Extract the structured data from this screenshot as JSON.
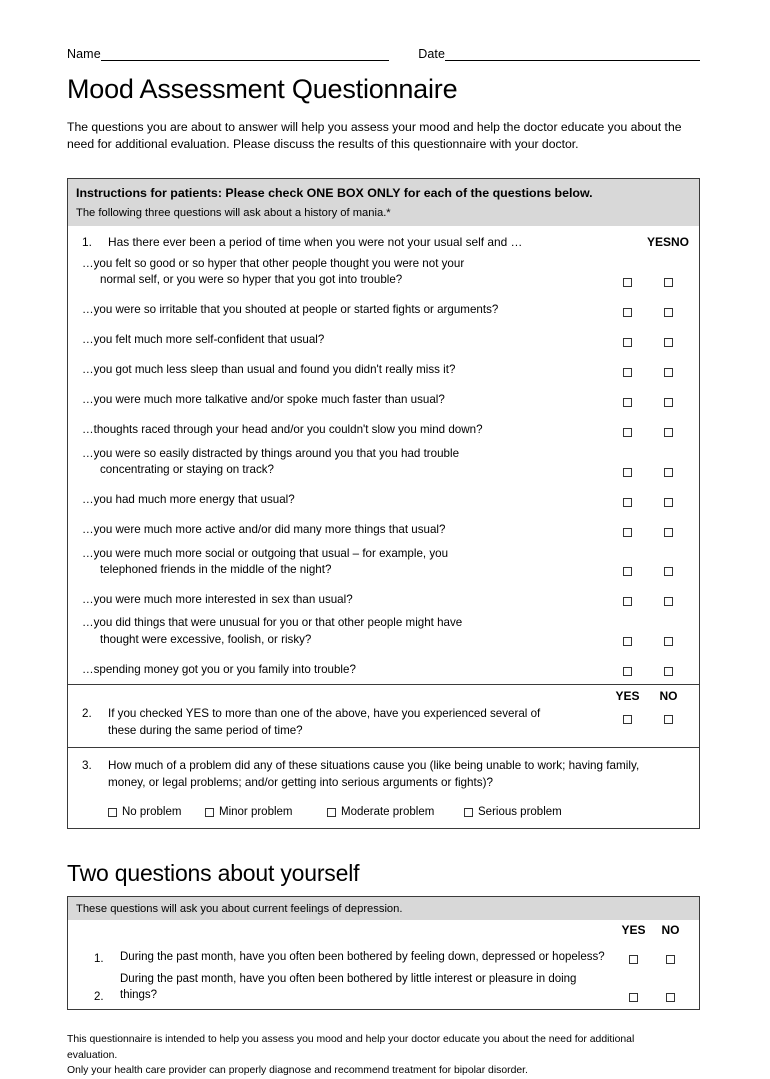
{
  "header": {
    "name_label": "Name",
    "date_label": "Date",
    "title": "Mood Assessment Questionnaire",
    "intro": "The questions you are about to answer will help you assess your mood and help the doctor educate you about the need for additional evaluation. Please discuss the results of this questionnaire with your doctor."
  },
  "mania": {
    "instructions_bold": "Instructions for patients: Please check ONE BOX ONLY for each of the questions below.",
    "instructions_sub": "The following three questions will ask about a history of mania.*",
    "yes_label": "YES",
    "no_label": "NO",
    "q1": {
      "number": "1.",
      "label": "Has there ever been a period of time when you were not your usual self and …",
      "items": [
        {
          "line1": "…you felt so good or so hyper that other people thought you were not your",
          "line2": "normal self, or you were so hyper that you got into trouble?"
        },
        {
          "line1": "…you were so irritable that you shouted at people or started fights or arguments?",
          "line2": ""
        },
        {
          "line1": "…you felt much more self-confident that usual?",
          "line2": ""
        },
        {
          "line1": "…you got much less sleep than usual and found you didn't really miss it?",
          "line2": ""
        },
        {
          "line1": "…you were much more talkative and/or spoke much faster than usual?",
          "line2": ""
        },
        {
          "line1": "…thoughts raced through your head and/or you couldn't slow you mind down?",
          "line2": ""
        },
        {
          "line1": "…you were so easily distracted by things around you that you had trouble",
          "line2": "concentrating or staying on track?"
        },
        {
          "line1": "…you had much more energy that usual?",
          "line2": ""
        },
        {
          "line1": "…you were much more active and/or did many more things that usual?",
          "line2": ""
        },
        {
          "line1": "…you were much more social or outgoing that usual – for example, you",
          "line2": "telephoned friends in the middle of the night?"
        },
        {
          "line1": "…you were much more interested in sex than usual?",
          "line2": ""
        },
        {
          "line1": "…you did things that were unusual for you or that other people might have",
          "line2": "thought were excessive, foolish, or risky?"
        },
        {
          "line1": "…spending money got you or you family into trouble?",
          "line2": ""
        }
      ]
    },
    "q2": {
      "number": "2.",
      "line1": "If you checked YES to more than one of the above, have you experienced several of",
      "line2": "these during the same period of time?"
    },
    "q3": {
      "number": "3.",
      "line1": "How much of a problem did any of these situations cause you (like being unable to work; having family,",
      "line2": "money, or legal problems; and/or getting into serious arguments or fights)?",
      "options": [
        "No problem",
        "Minor problem",
        "Moderate problem",
        "Serious problem"
      ]
    }
  },
  "depression": {
    "section_title": "Two questions about yourself",
    "instructions_sub": "These questions will ask you about current feelings of depression.",
    "yes_label": "YES",
    "no_label": "NO",
    "items": [
      {
        "number": "1.",
        "text": "During the past month, have you often been bothered by feeling down, depressed or hopeless?"
      },
      {
        "number": "2.",
        "text": "During the past month, have you often been bothered by little interest or pleasure in doing things?"
      }
    ]
  },
  "footer": {
    "line1": "This questionnaire is intended to help you assess you mood and help your doctor educate you about the need for additional evaluation.",
    "line2": "Only your health care provider can properly diagnose and recommend treatment for bipolar disorder."
  },
  "colors": {
    "band_gray": "#d8d8d8",
    "border": "#3a3a3a"
  }
}
